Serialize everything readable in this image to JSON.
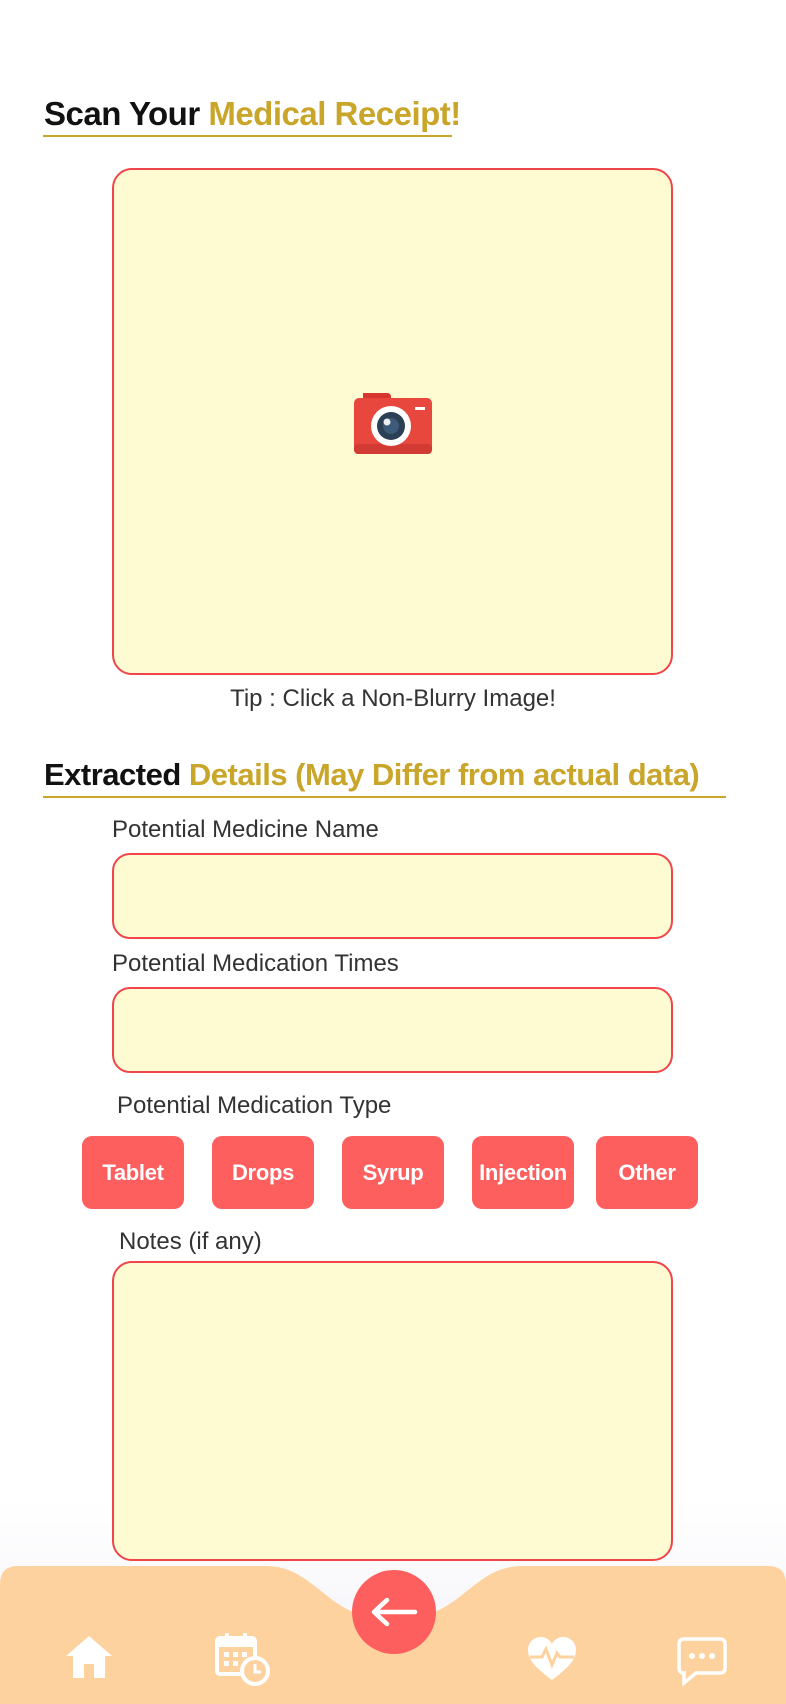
{
  "scan_heading": {
    "part1": "Scan Your ",
    "part2": "Medical Receipt!"
  },
  "scan_area": {
    "icon": "camera-icon"
  },
  "tip": "Tip : Click a Non-Blurry Image!",
  "details_heading": {
    "part1": "Extracted ",
    "part2": "Details (May Differ from actual data)"
  },
  "fields": {
    "medicine_name": {
      "label": "Potential Medicine Name",
      "value": ""
    },
    "medication_times": {
      "label": "Potential Medication Times",
      "value": ""
    },
    "medication_type": {
      "label": "Potential Medication Type"
    },
    "notes": {
      "label": "Notes (if any)",
      "value": ""
    }
  },
  "medication_types": [
    "Tablet",
    "Drops",
    "Syrup",
    "Injection",
    "Other"
  ],
  "nav": {
    "items": [
      "home-icon",
      "calendar-clock-icon",
      "heart-pulse-icon",
      "chat-icon"
    ],
    "center": "arrow-left-icon"
  },
  "colors": {
    "accent_red": "#fd5f5f",
    "gold": "#c9a52a",
    "field_bg": "#fefbd2",
    "nav_bg": "#fdd29f"
  }
}
